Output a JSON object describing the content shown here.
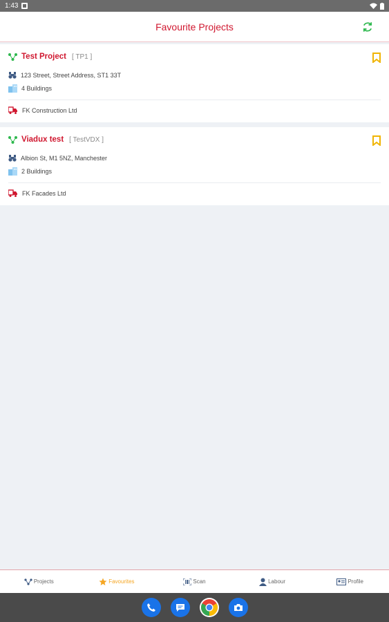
{
  "status_bar": {
    "time": "1:43"
  },
  "header": {
    "title": "Favourite Projects",
    "refresh_icon": "refresh-icon"
  },
  "projects": [
    {
      "name": "Test Project",
      "code": "[ TP1 ]",
      "address": "123 Street, Street Address, ST1 33T",
      "buildings": "4 Buildings",
      "company": "FK Construction Ltd"
    },
    {
      "name": "Viadux test",
      "code": "[ TestVDX ]",
      "address": "Albion St, M1 5NZ, Manchester",
      "buildings": "2 Buildings",
      "company": "FK Facades Ltd"
    }
  ],
  "tabs": [
    {
      "label": "Projects",
      "icon": "projects-icon"
    },
    {
      "label": "Favourites",
      "icon": "star-icon"
    },
    {
      "label": "Scan",
      "icon": "scan-icon"
    },
    {
      "label": "Labour",
      "icon": "person-icon"
    },
    {
      "label": "Profile",
      "icon": "id-card-icon"
    }
  ],
  "colors": {
    "brand_red": "#d0172f",
    "accent_green": "#2db84d",
    "bookmark_yellow": "#f0b400",
    "active_tab": "#f5a623"
  }
}
